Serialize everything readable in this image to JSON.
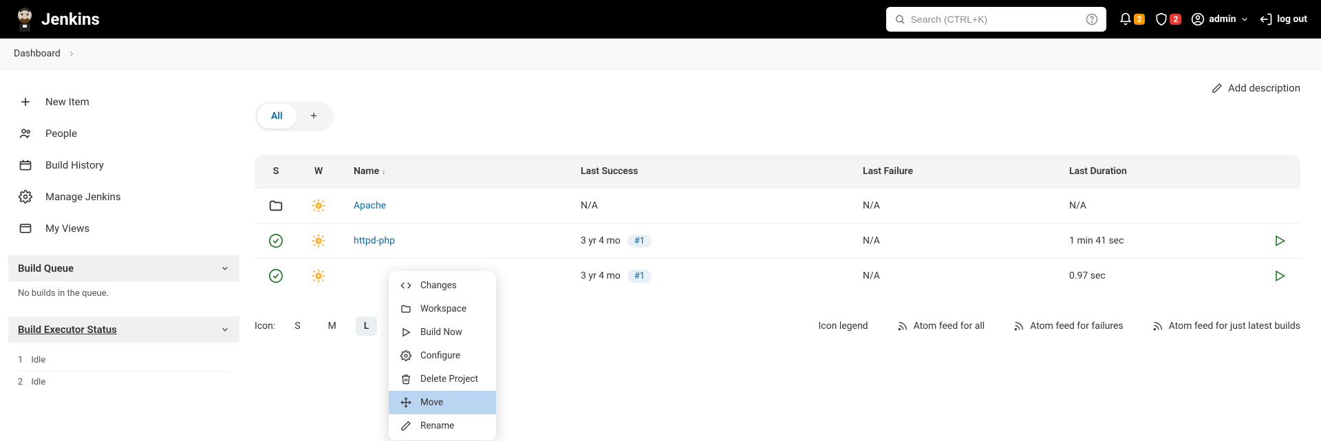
{
  "header": {
    "brand": "Jenkins",
    "search_placeholder": "Search (CTRL+K)",
    "notif_count": "2",
    "security_count": "2",
    "username": "admin",
    "logout": "log out"
  },
  "breadcrumb": {
    "root": "Dashboard"
  },
  "sidebar": {
    "items": [
      {
        "label": "New Item"
      },
      {
        "label": "People"
      },
      {
        "label": "Build History"
      },
      {
        "label": "Manage Jenkins"
      },
      {
        "label": "My Views"
      }
    ],
    "build_queue": {
      "title": "Build Queue",
      "empty": "No builds in the queue."
    },
    "executor": {
      "title": "Build Executor Status",
      "rows": [
        {
          "num": "1",
          "state": "Idle"
        },
        {
          "num": "2",
          "state": "Idle"
        }
      ]
    }
  },
  "main": {
    "add_description": "Add description",
    "tab_all": "All",
    "columns": {
      "s": "S",
      "w": "W",
      "name": "Name",
      "last_success": "Last Success",
      "last_failure": "Last Failure",
      "last_duration": "Last Duration"
    },
    "rows": [
      {
        "status": "folder",
        "weather": "sun",
        "name": "Apache",
        "last_success": "N/A",
        "build": "",
        "last_failure": "N/A",
        "last_duration": "N/A",
        "runnable": false
      },
      {
        "status": "ok",
        "weather": "sun",
        "name": "httpd-php",
        "last_success": "3 yr 4 mo",
        "build": "#1",
        "last_failure": "N/A",
        "last_duration": "1 min 41 sec",
        "runnable": true
      },
      {
        "status": "ok",
        "weather": "sun",
        "name": "",
        "last_success": "3 yr 4 mo",
        "build": "#1",
        "last_failure": "N/A",
        "last_duration": "0.97 sec",
        "runnable": true
      }
    ],
    "footer": {
      "icon_label": "Icon:",
      "sizes": [
        "S",
        "M",
        "L"
      ],
      "active_size": "L",
      "legend": "Icon legend",
      "feeds": [
        "Atom feed for all",
        "Atom feed for failures",
        "Atom feed for just latest builds"
      ]
    }
  },
  "ctx": {
    "items": [
      {
        "label": "Changes"
      },
      {
        "label": "Workspace"
      },
      {
        "label": "Build Now"
      },
      {
        "label": "Configure"
      },
      {
        "label": "Delete Project"
      },
      {
        "label": "Move"
      },
      {
        "label": "Rename"
      }
    ]
  }
}
